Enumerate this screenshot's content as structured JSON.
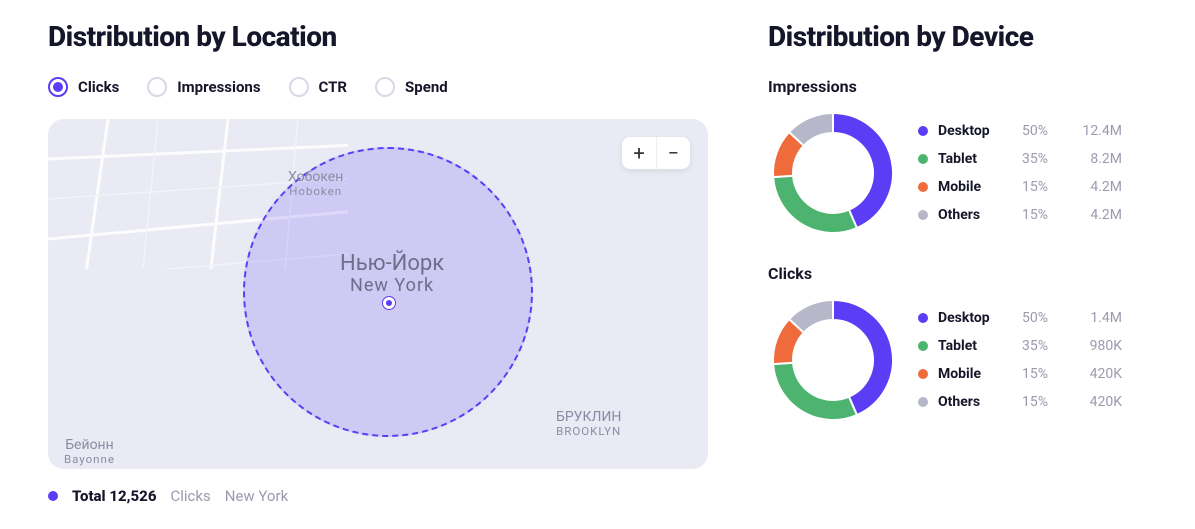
{
  "colors": {
    "accent": "#5b3df5",
    "desktop": "#5b3df5",
    "tablet": "#4cb46f",
    "mobile": "#f06b3c",
    "others": "#b6b7c8"
  },
  "location": {
    "title": "Distribution by Location",
    "tabs": [
      {
        "label": "Clicks",
        "active": true
      },
      {
        "label": "Impressions",
        "active": false
      },
      {
        "label": "CTR",
        "active": false
      },
      {
        "label": "Spend",
        "active": false
      }
    ],
    "map": {
      "zoom_in": "+",
      "zoom_out": "−",
      "labels": {
        "main_native": "Нью-Йорк",
        "main_en": "New York",
        "hoboken_native": "Хобокен",
        "hoboken_en": "Hoboken",
        "brooklyn_native": "БРУКЛИН",
        "brooklyn_en": "BROOKLYN",
        "bayonne_native": "Бейонн",
        "bayonne_en": "Bayonne"
      }
    },
    "summary": {
      "total_label": "Total",
      "total_value": "12,526",
      "metric": "Clicks",
      "place": "New York"
    }
  },
  "device": {
    "title": "Distribution by Device",
    "sections": [
      {
        "title": "Impressions",
        "rows": [
          {
            "name": "Desktop",
            "pct": "50%",
            "value": "12.4M",
            "color": "#5b3df5"
          },
          {
            "name": "Tablet",
            "pct": "35%",
            "value": "8.2M",
            "color": "#4cb46f"
          },
          {
            "name": "Mobile",
            "pct": "15%",
            "value": "4.2M",
            "color": "#f06b3c"
          },
          {
            "name": "Others",
            "pct": "15%",
            "value": "4.2M",
            "color": "#b6b7c8"
          }
        ]
      },
      {
        "title": "Clicks",
        "rows": [
          {
            "name": "Desktop",
            "pct": "50%",
            "value": "1.4M",
            "color": "#5b3df5"
          },
          {
            "name": "Tablet",
            "pct": "35%",
            "value": "980K",
            "color": "#4cb46f"
          },
          {
            "name": "Mobile",
            "pct": "15%",
            "value": "420K",
            "color": "#f06b3c"
          },
          {
            "name": "Others",
            "pct": "15%",
            "value": "420K",
            "color": "#b6b7c8"
          }
        ]
      }
    ]
  },
  "chart_data": [
    {
      "type": "pie",
      "title": "Impressions by Device",
      "series": [
        {
          "name": "Desktop",
          "value": 12.4,
          "unit": "M",
          "pct": 50
        },
        {
          "name": "Tablet",
          "value": 8.2,
          "unit": "M",
          "pct": 35
        },
        {
          "name": "Mobile",
          "value": 4.2,
          "unit": "M",
          "pct": 15
        },
        {
          "name": "Others",
          "value": 4.2,
          "unit": "M",
          "pct": 15
        }
      ]
    },
    {
      "type": "pie",
      "title": "Clicks by Device",
      "series": [
        {
          "name": "Desktop",
          "value": 1.4,
          "unit": "M",
          "pct": 50
        },
        {
          "name": "Tablet",
          "value": 0.98,
          "unit": "M",
          "pct": 35
        },
        {
          "name": "Mobile",
          "value": 0.42,
          "unit": "M",
          "pct": 15
        },
        {
          "name": "Others",
          "value": 0.42,
          "unit": "M",
          "pct": 15
        }
      ]
    }
  ]
}
